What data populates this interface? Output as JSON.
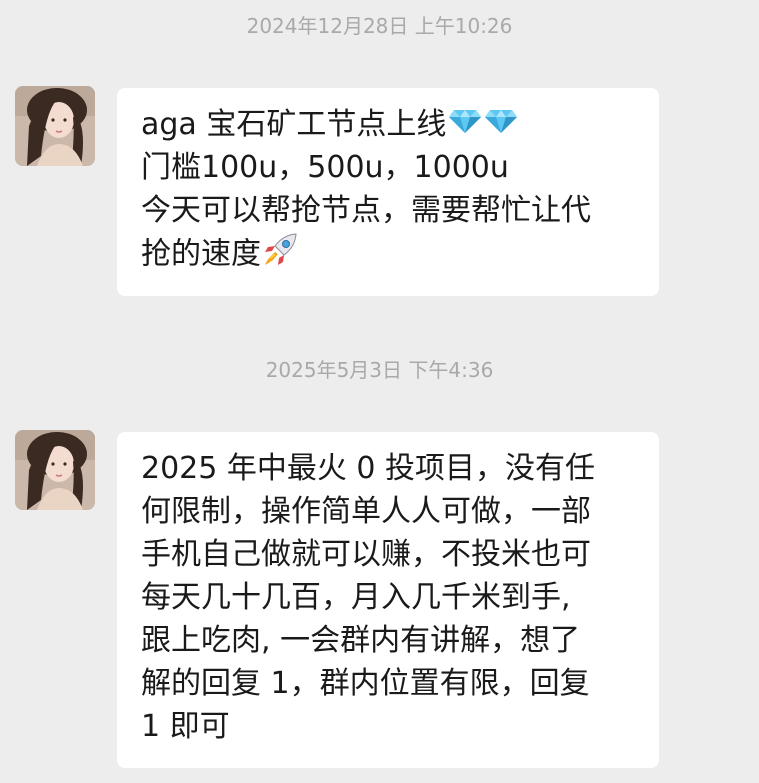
{
  "chat": {
    "messages": [
      {
        "timestamp": "2024年12月28日 上午10:26",
        "lines": [
          "aga 宝石矿工节点上线",
          "门槛100u，500u，1000u",
          "今天可以帮抢节点，需要帮忙让代",
          "抢的速度"
        ],
        "line1_icons": [
          "gem-icon",
          "gem-icon"
        ],
        "line4_icon": "rocket-icon"
      },
      {
        "timestamp": "2025年5月3日 下午4:36",
        "lines": [
          "2025 年中最火 0 投项目，没有任",
          "何限制，操作简单人人可做，一部",
          "手机自己做就可以赚，不投米也可",
          "每天几十几百，月入几千米到手,",
          "跟上吃肉, 一会群内有讲解，想了",
          "解的回复 1，群内位置有限，回复",
          "1 即可"
        ]
      }
    ]
  },
  "colors": {
    "background": "#ededed",
    "bubble": "#ffffff",
    "timestamp": "#a9a9a9",
    "text": "#1a1a1a"
  }
}
